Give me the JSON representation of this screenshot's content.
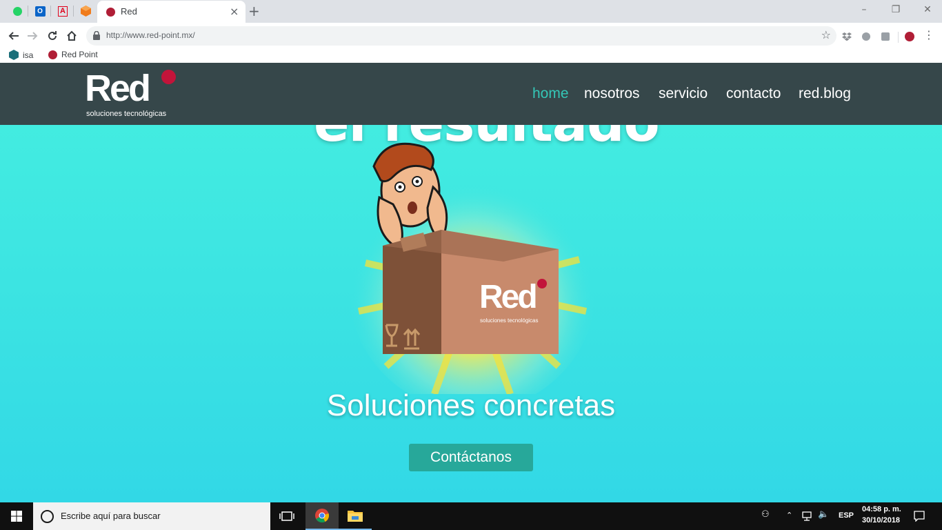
{
  "browser": {
    "pinned_tabs": [
      {
        "icon": "whatsapp-icon",
        "color": "#25d366"
      },
      {
        "icon": "outlook-icon",
        "color": "#0a64c8"
      },
      {
        "icon": "adobe-icon",
        "color": "#e0001b"
      },
      {
        "icon": "package-icon",
        "color": "#f07b1b"
      }
    ],
    "active_tab": {
      "title": "Red",
      "favicon_color": "#b01e36"
    },
    "close_glyph": "×",
    "newtab_glyph": "+",
    "window_controls": {
      "minimize": "–",
      "restore": "❐",
      "close": "✕"
    },
    "url": "http://www.red-point.mx/",
    "bookmarks": [
      {
        "label": "isa",
        "icon": "hexagon-icon"
      },
      {
        "label": "Red Point",
        "icon": "red-dot-icon"
      }
    ]
  },
  "site": {
    "logo": {
      "text": "Red",
      "subtitle": "soluciones tecnológicas",
      "dot_color": "#c2143a"
    },
    "nav": [
      {
        "label": "home",
        "active": true
      },
      {
        "label": "nosotros",
        "active": false
      },
      {
        "label": "servicio",
        "active": false
      },
      {
        "label": "contacto",
        "active": false
      },
      {
        "label": "red.blog",
        "active": false
      }
    ],
    "background_heading": "el resultado",
    "box_logo": {
      "text": "Red",
      "subtitle": "soluciones tecnológicas"
    },
    "headline": "Soluciones concretas",
    "cta_label": "Contáctanos",
    "colors": {
      "header": "#36474a",
      "accent": "#34c7b7",
      "cta": "#27a89a",
      "hero": "#3ce4e2"
    }
  },
  "taskbar": {
    "search_placeholder": "Escribe aquí para buscar",
    "language": "ESP",
    "time": "04:58 p. m.",
    "date": "30/10/2018"
  }
}
